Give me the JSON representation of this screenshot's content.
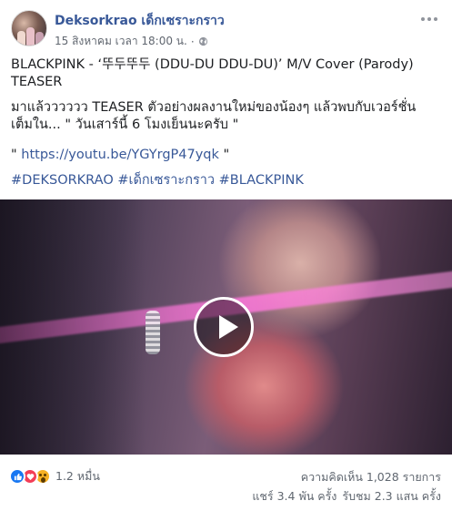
{
  "post": {
    "page_name": "Deksorkrao เด็กเซราะกราว",
    "timestamp": "15 สิงหาคม เวลา 18:00 น.",
    "separator": "·",
    "title_line1": "BLACKPINK - ‘뚜두뚜두 (DDU-DU DDU-DU)’ M/V Cover (Parody)",
    "title_line2": "TEASER",
    "body_line1": "มาแล้วววววว TEASER ตัวอย่างผลงานใหม่ของน้องๆ แล้วพบกับเวอร์ชั่น",
    "body_line2": "เต็มใน... \" วันเสาร์นี้ 6 โมงเย็นนะครับ \"",
    "link_prefix": "\" ",
    "link": "https://youtu.be/YGYrgP47yqk",
    "link_suffix": " \"",
    "hashtags": [
      "#DEKSORKRAO",
      "#เด็กเซราะกราว",
      "#BLACKPINK"
    ]
  },
  "stats": {
    "reactions_count": "1.2 หมื่น",
    "comments": "ความคิดเห็น 1,028 รายการ",
    "shares": "แชร์ 3.4 พัน ครั้ง",
    "views": "รับชม 2.3 แสน ครั้ง"
  },
  "icons": {
    "reactions": [
      "like-icon",
      "love-icon",
      "wow-icon"
    ],
    "privacy": "globe-icon",
    "menu": "more-icon",
    "video": "play-icon"
  },
  "colors": {
    "link": "#385898",
    "like": "#1877f2",
    "love": "#f33e58",
    "wow": "#f7b125"
  }
}
